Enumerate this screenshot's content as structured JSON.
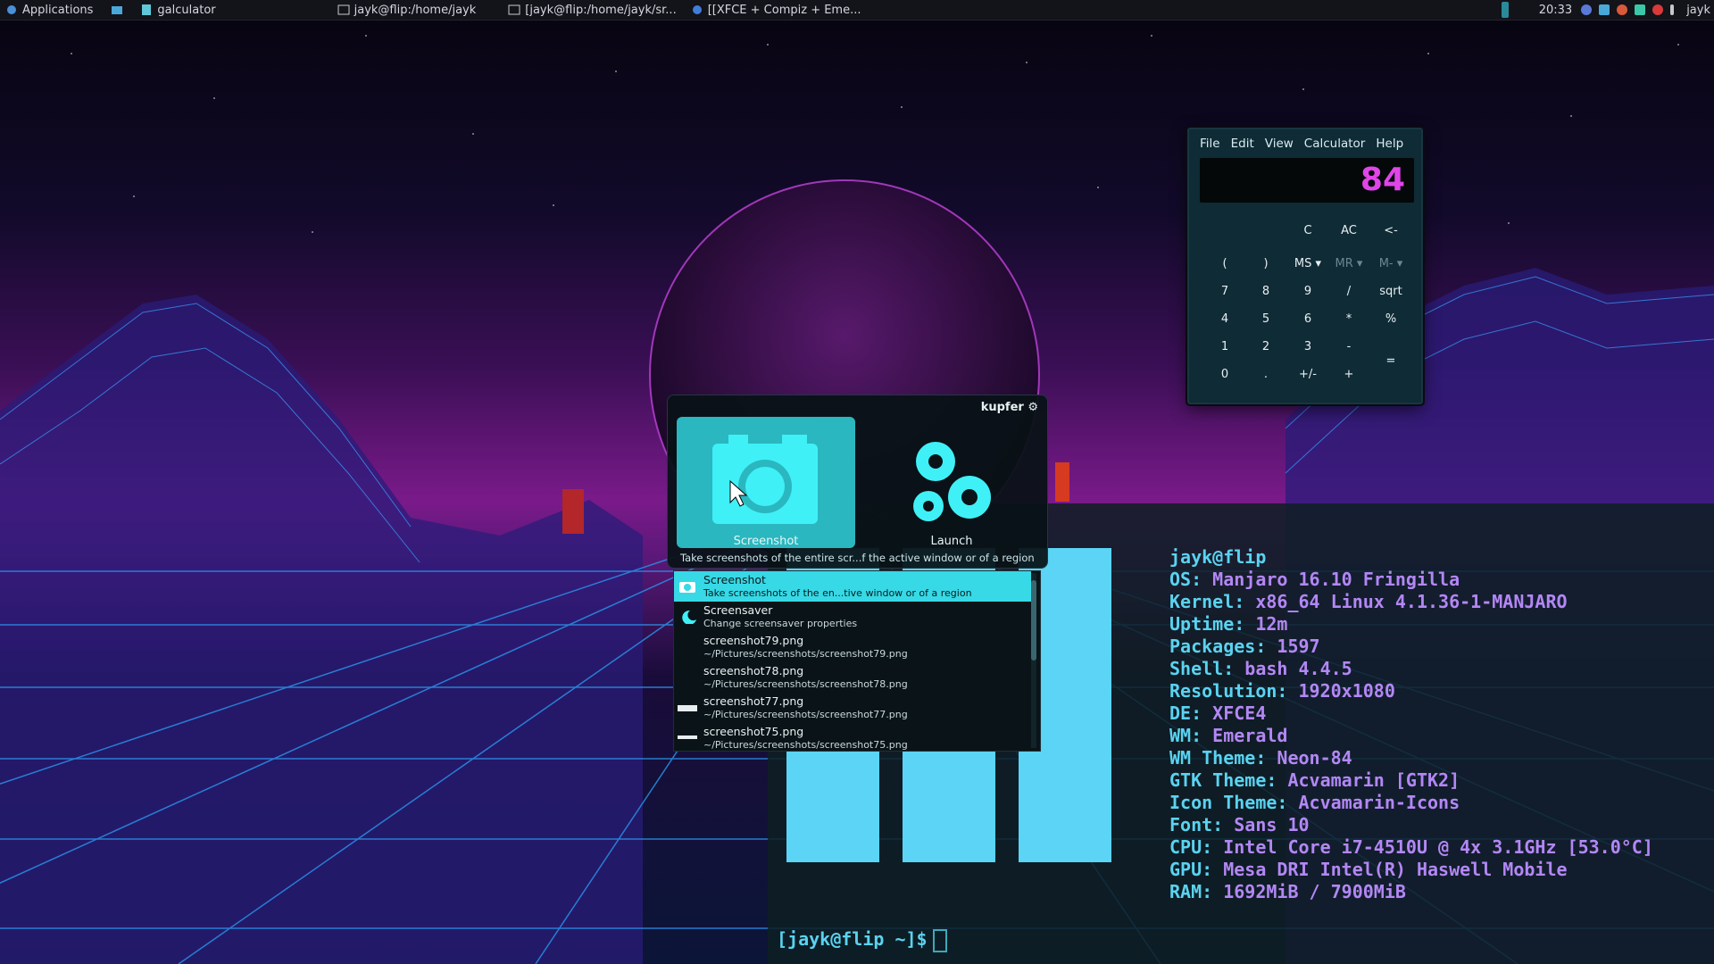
{
  "panel": {
    "apps_label": "Applications",
    "tasks": [
      {
        "label": "galculator"
      },
      {
        "label": "jayk@flip:/home/jayk"
      },
      {
        "label": "[jayk@flip:/home/jayk/sr..."
      },
      {
        "label": "[[XFCE + Compiz + Eme..."
      }
    ],
    "clock": "20:33",
    "user": "jayk"
  },
  "calculator": {
    "menu": [
      "File",
      "Edit",
      "View",
      "Calculator",
      "Help"
    ],
    "display": "84",
    "buttons": [
      "C",
      "AC",
      "<-",
      "(",
      ")",
      "MS ▾",
      "MR ▾",
      "M- ▾",
      "7",
      "8",
      "9",
      "/",
      "sqrt",
      "4",
      "5",
      "6",
      "*",
      "%",
      "1",
      "2",
      "3",
      "-",
      "=",
      "0",
      ".",
      "+/-",
      "+"
    ]
  },
  "kupfer": {
    "title": "kupfer ⚙",
    "object_label": "Screenshot",
    "action_label": "Launch",
    "description": "Take screenshots of the entire scr...f the active window or of a region",
    "items": [
      {
        "title": "Screenshot",
        "subtitle": "Take screenshots of the en...tive window or of a region"
      },
      {
        "title": "Screensaver",
        "subtitle": "Change screensaver properties"
      },
      {
        "title": "screenshot79.png",
        "subtitle": "~/Pictures/screenshots/screenshot79.png"
      },
      {
        "title": "screenshot78.png",
        "subtitle": "~/Pictures/screenshots/screenshot78.png"
      },
      {
        "title": "screenshot77.png",
        "subtitle": "~/Pictures/screenshots/screenshot77.png"
      },
      {
        "title": "screenshot75.png",
        "subtitle": "~/Pictures/screenshots/screenshot75.png"
      }
    ]
  },
  "terminal": {
    "header": "jayk@flip",
    "info": [
      {
        "key": "OS:",
        "value": "Manjaro 16.10 Fringilla"
      },
      {
        "key": "Kernel:",
        "value": "x86_64 Linux 4.1.36-1-MANJARO"
      },
      {
        "key": "Uptime:",
        "value": "12m"
      },
      {
        "key": "Packages:",
        "value": "1597"
      },
      {
        "key": "Shell:",
        "value": "bash 4.4.5"
      },
      {
        "key": "Resolution:",
        "value": "1920x1080"
      },
      {
        "key": "DE:",
        "value": "XFCE4"
      },
      {
        "key": "WM:",
        "value": "Emerald"
      },
      {
        "key": "WM Theme:",
        "value": "Neon-84"
      },
      {
        "key": "GTK Theme:",
        "value": "Acvamarin [GTK2]"
      },
      {
        "key": "Icon Theme:",
        "value": "Acvamarin-Icons"
      },
      {
        "key": "Font:",
        "value": "Sans 10"
      },
      {
        "key": "CPU:",
        "value": "Intel Core i7-4510U @ 4x 3.1GHz [53.0°C]"
      },
      {
        "key": "GPU:",
        "value": "Mesa DRI Intel(R) Haswell Mobile"
      },
      {
        "key": "RAM:",
        "value": "1692MiB / 7900MiB"
      }
    ],
    "prompt": "[jayk@flip ~]$"
  },
  "colors": {
    "accent": "#37d9e6",
    "display_text": "#e045e8",
    "terminal_key": "#5ad3f0",
    "terminal_value": "#b387f5"
  }
}
